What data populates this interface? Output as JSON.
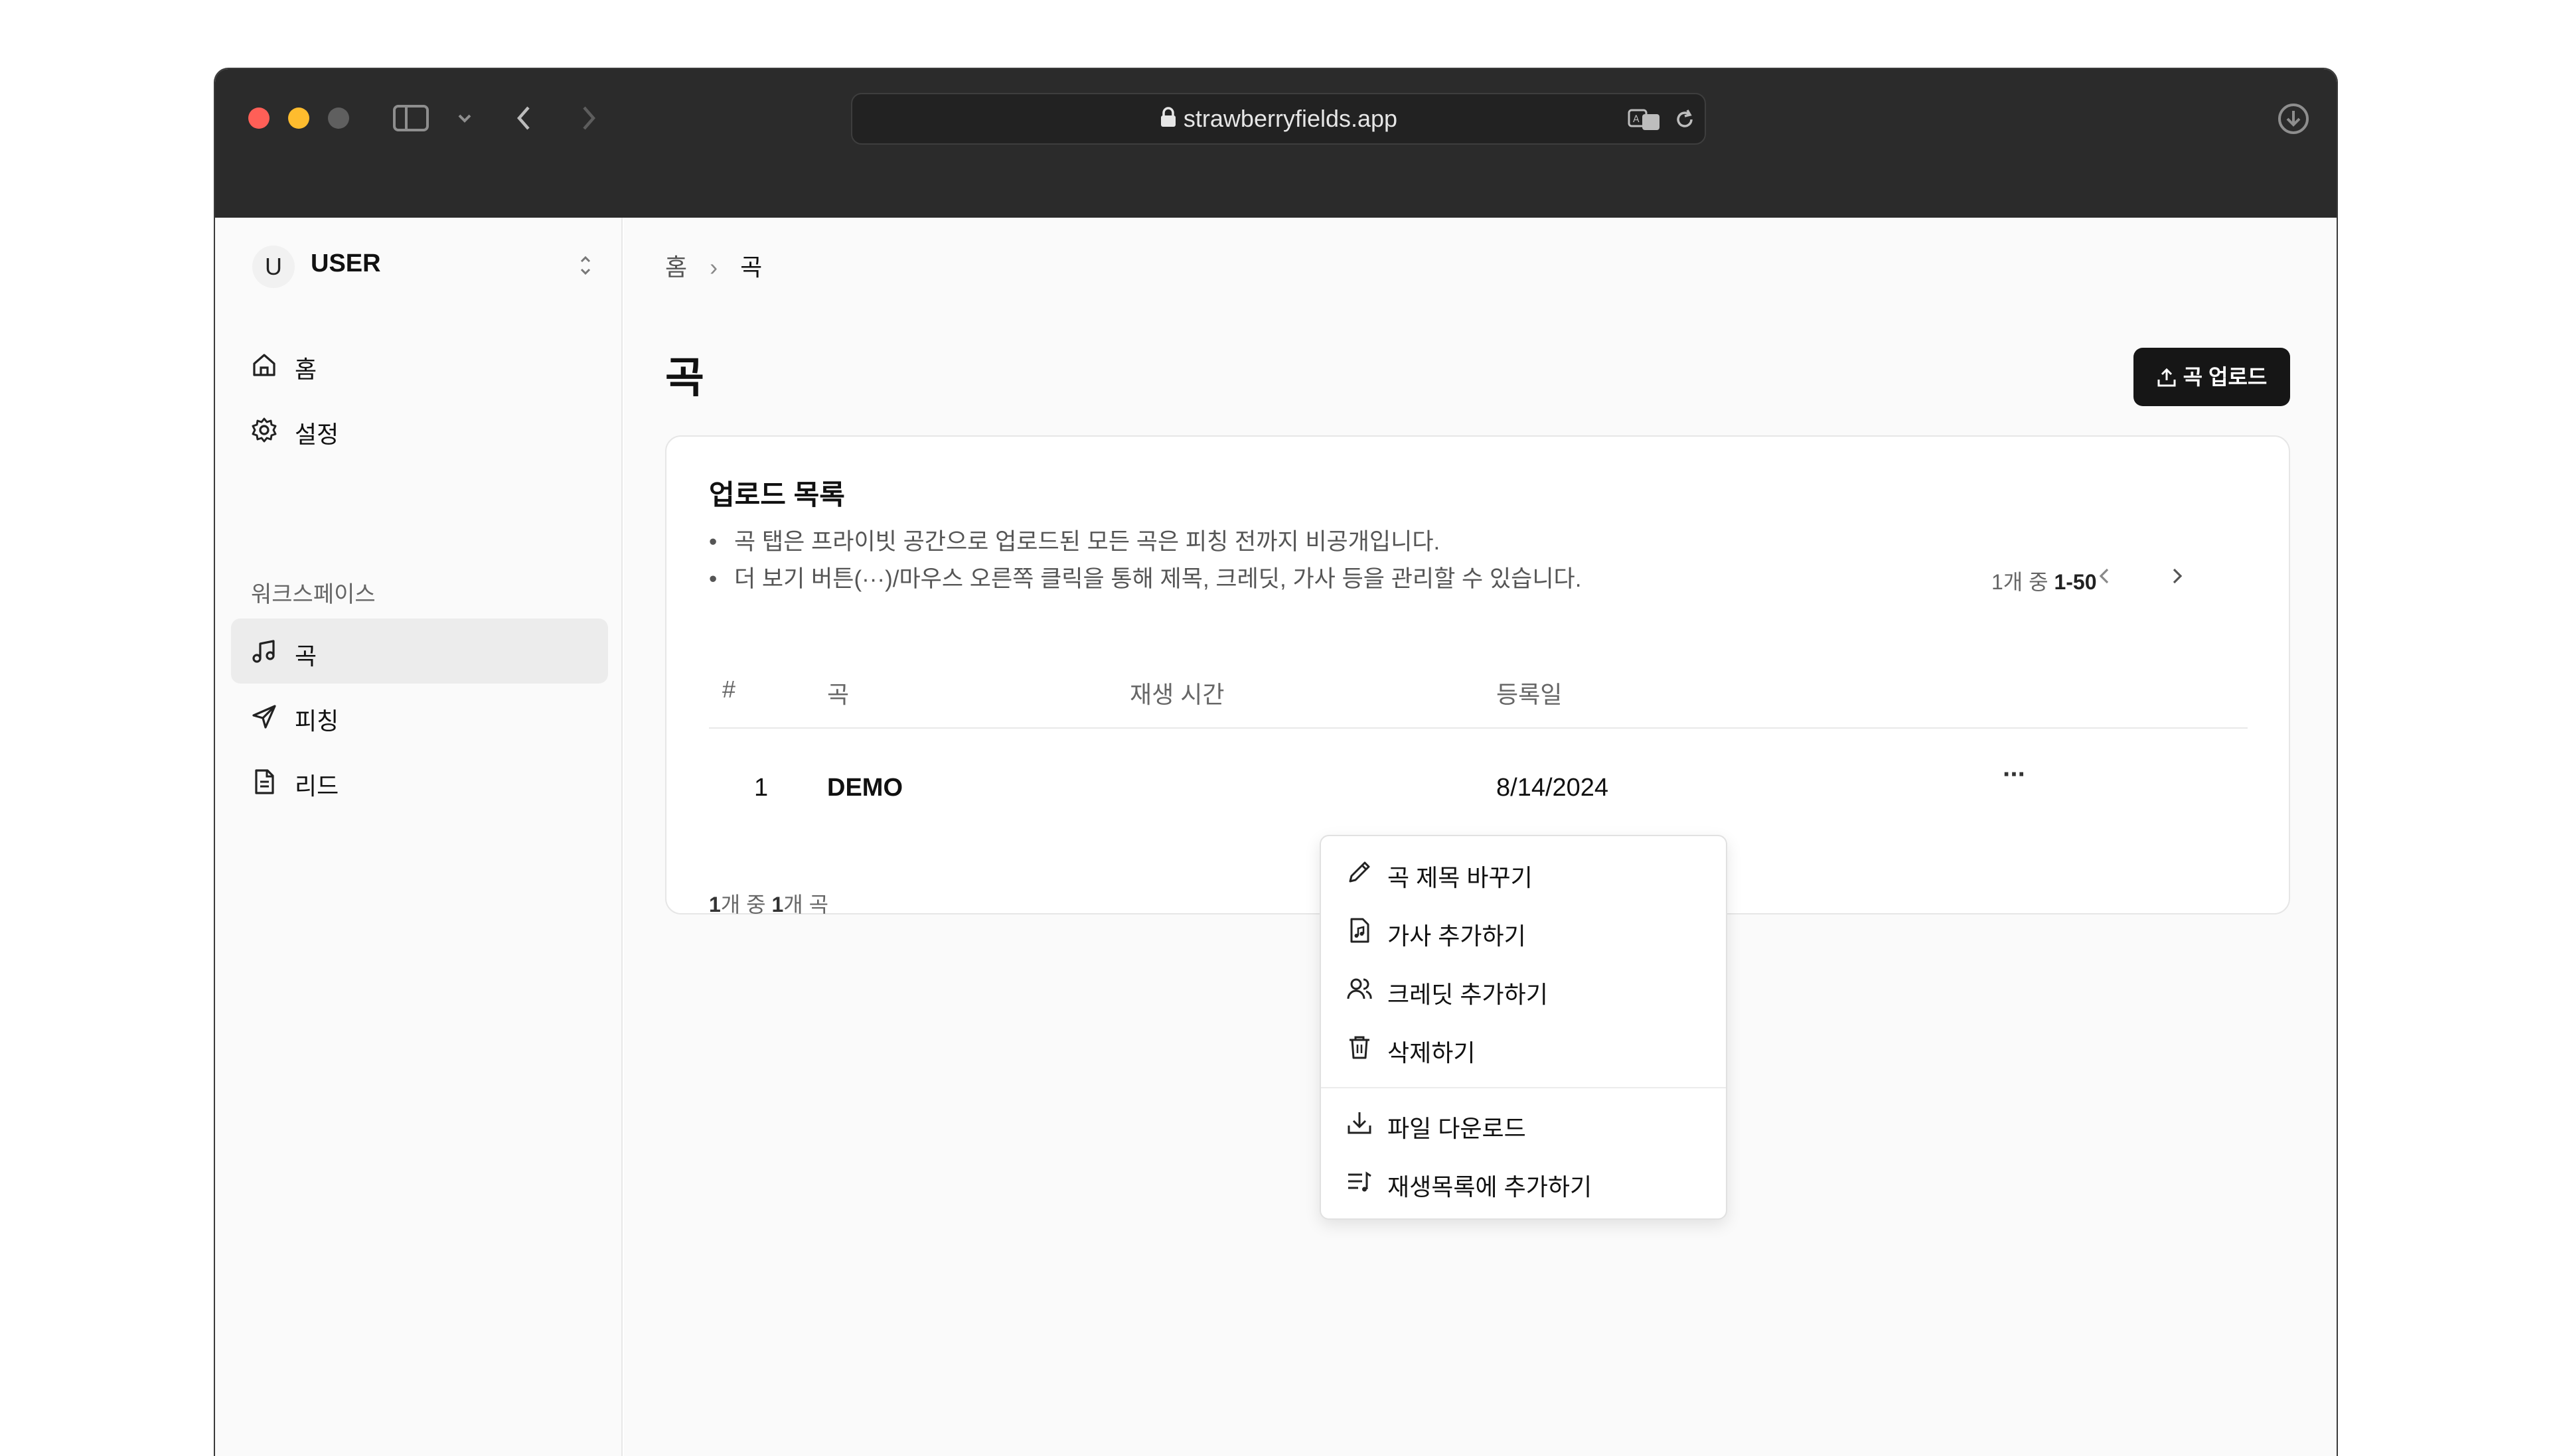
{
  "browser": {
    "url": "strawberryfields.app",
    "colors": {
      "close": "#ff5f57",
      "minimize": "#febc2e",
      "maximize_disabled": "#5f5f5f"
    }
  },
  "sidebar": {
    "user": {
      "avatar_letter": "U",
      "name": "USER"
    },
    "main_items": [
      {
        "label": "홈",
        "icon": "home-icon"
      },
      {
        "label": "설정",
        "icon": "gear-icon"
      }
    ],
    "section_label": "워크스페이스",
    "workspace_items": [
      {
        "label": "곡",
        "icon": "music-note-icon",
        "active": true
      },
      {
        "label": "피칭",
        "icon": "send-icon"
      },
      {
        "label": "리드",
        "icon": "file-text-icon"
      }
    ]
  },
  "header": {
    "breadcrumbs": [
      "홈",
      "곡"
    ],
    "instagram_icon": "instagram-icon",
    "theme_icon": "sun-icon"
  },
  "page": {
    "title": "곡",
    "upload_button": "곡 업로드"
  },
  "card": {
    "title": "업로드 목록",
    "notes": [
      "곡 탭은 프라이빗 공간으로 업로드된 모든 곡은 피칭 전까지 비공개입니다.",
      "더 보기 버튼(···)/마우스 오른쪽 클릭을 통해 제목, 크레딧, 가사 등을 관리할 수 있습니다."
    ],
    "pager": {
      "prefix": "1개 중 ",
      "range": "1-50"
    },
    "columns": [
      "#",
      "곡",
      "재생 시간",
      "등록일"
    ],
    "rows": [
      {
        "index": "1",
        "title": "DEMO",
        "duration": "",
        "date": "8/14/2024"
      }
    ],
    "footer": {
      "a": "1",
      "mid": "개 중 ",
      "b": "1",
      "suffix": "개 곡"
    }
  },
  "context_menu": {
    "items": [
      {
        "label": "곡 제목 바꾸기",
        "icon": "pencil-icon"
      },
      {
        "label": "가사 추가하기",
        "icon": "lyrics-file-icon"
      },
      {
        "label": "크레딧 추가하기",
        "icon": "users-icon"
      },
      {
        "label": "삭제하기",
        "icon": "trash-icon"
      },
      {
        "label": "파일 다운로드",
        "icon": "download-icon"
      },
      {
        "label": "재생목록에 추가하기",
        "icon": "playlist-add-icon"
      }
    ]
  }
}
